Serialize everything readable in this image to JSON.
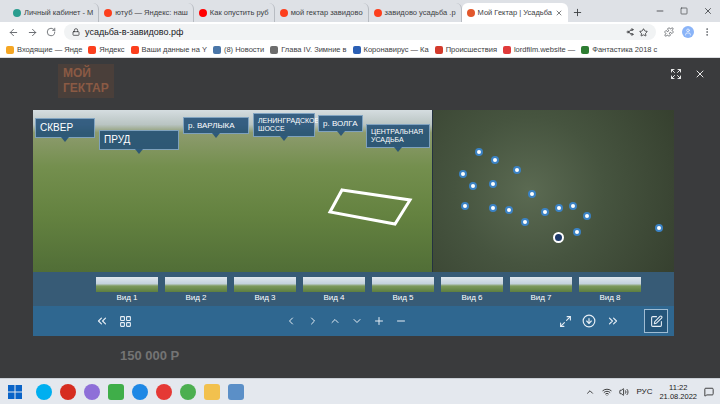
{
  "browser": {
    "tabs": [
      {
        "label": "Личный кабинет - М",
        "selected": false,
        "color": "#2a9d8f"
      },
      {
        "label": "ютуб — Яндекс: наш",
        "selected": false,
        "color": "#fc3f1d"
      },
      {
        "label": "Как опустить руб",
        "selected": false,
        "color": "#ff0000"
      },
      {
        "label": "мой гектар завидово",
        "selected": false,
        "color": "#fc3f1d"
      },
      {
        "label": "завидово усадьба .р",
        "selected": false,
        "color": "#fc3f1d"
      },
      {
        "label": "Мой Гектар | Усадьба",
        "selected": true,
        "color": "#e2572b"
      }
    ],
    "address": "усадьба-в-завидово.рф",
    "bookmarks": [
      {
        "label": "Входящие — Янде",
        "color": "#f5a623"
      },
      {
        "label": "Яндекс",
        "color": "#fc3f1d"
      },
      {
        "label": "Ваши данные на Y",
        "color": "#fc3f1d"
      },
      {
        "label": "(8) Новости",
        "color": "#4a76a8"
      },
      {
        "label": "Глава IV. Зимние в",
        "color": "#6d6d6d"
      },
      {
        "label": "Коронавирус — Ка",
        "color": "#2b5fb4"
      },
      {
        "label": "Происшествия",
        "color": "#d33a2c"
      },
      {
        "label": "lordfilm.website —",
        "color": "#e03a3a"
      },
      {
        "label": "Фантастика 2018 с",
        "color": "#2e7d32"
      }
    ]
  },
  "page": {
    "logo": [
      "МОЙ",
      "ГЕКТАР"
    ],
    "price": "150 000 Р"
  },
  "viewer": {
    "labels": [
      "СКВЕР",
      "ПРУД",
      "р. ВАРЛЫКА",
      "ЛЕНИНГРАДСКОЕ ШОССЕ",
      "р. ВОЛГА",
      "ЦЕНТРАЛЬНАЯ УСАДЬБА"
    ],
    "views": [
      {
        "label": "Вид 1",
        "selected": false
      },
      {
        "label": "Вид 2",
        "selected": false
      },
      {
        "label": "Вид 3",
        "selected": false
      },
      {
        "label": "Вид 4",
        "selected": false
      },
      {
        "label": "Вид 5",
        "selected": false
      },
      {
        "label": "Вид 6",
        "selected": false
      },
      {
        "label": "Вид 7",
        "selected": false
      },
      {
        "label": "Вид 8",
        "selected": false
      }
    ],
    "map_pins": [
      {
        "selected": false
      },
      {
        "selected": false
      },
      {
        "selected": false
      },
      {
        "selected": false
      },
      {
        "selected": false
      },
      {
        "selected": false
      },
      {
        "selected": false
      },
      {
        "selected": false
      },
      {
        "selected": false
      },
      {
        "selected": false
      },
      {
        "selected": false
      },
      {
        "selected": false
      },
      {
        "selected": false
      },
      {
        "selected": false
      },
      {
        "selected": false
      },
      {
        "selected": false
      },
      {
        "selected": false
      },
      {
        "selected": true
      }
    ]
  },
  "taskbar": {
    "language": "РУС",
    "time": "11:22",
    "date": "21.08.2022"
  }
}
